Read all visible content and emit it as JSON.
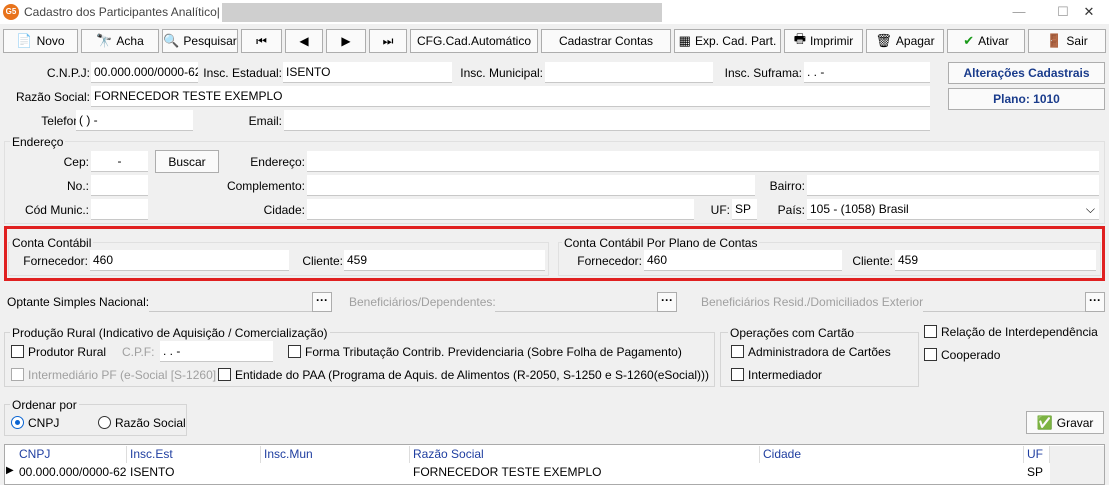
{
  "window": {
    "title": "Cadastro dos Participantes Analítico|",
    "icon_text": "G5"
  },
  "toolbar": {
    "novo": "Novo",
    "acha": "Acha",
    "pesquisar": "Pesquisar",
    "cfg": "CFG.Cad.Automático",
    "cadastrar_contas": "Cadastrar Contas",
    "exp": "Exp. Cad. Part.",
    "imprimir": "Imprimir",
    "apagar": "Apagar",
    "ativar": "Ativar",
    "sair": "Sair"
  },
  "side": {
    "alteracoes": "Alterações Cadastrais",
    "plano": "Plano: 1010"
  },
  "ident": {
    "cnpj_label": "C.N.P.J:",
    "cnpj": "00.000.000/0000-62",
    "ie_label": "Insc. Estadual:",
    "ie": "ISENTO",
    "im_label": "Insc. Municipal:",
    "im": "",
    "suframa_label": "Insc. Suframa:",
    "suframa": " .   .  -",
    "razao_label": "Razão Social:",
    "razao": "FORNECEDOR TESTE EXEMPLO",
    "tel_label": "Telefone:",
    "tel": "(  )    -",
    "email_label": "Email:",
    "email": ""
  },
  "endereco": {
    "group": "Endereço",
    "cep_label": "Cep:",
    "cep": "-",
    "buscar": "Buscar",
    "endereco_label": "Endereço:",
    "no_label": "No.:",
    "complemento_label": "Complemento:",
    "bairro_label": "Bairro:",
    "codmun_label": "Cód Munic.:",
    "cidade_label": "Cidade:",
    "uf_label": "UF:",
    "uf": "SP",
    "pais_label": "País:",
    "pais": "105 - (1058) Brasil"
  },
  "conta": {
    "group1": "Conta Contábil",
    "fornecedor_label": "Fornecedor:",
    "fornecedor": "460",
    "cliente_label": "Cliente:",
    "cliente": "459",
    "group2": "Conta Contábil Por Plano de Contas",
    "fornecedor2": "460",
    "cliente2": "459"
  },
  "extra": {
    "simples": "Optante Simples Nacional:",
    "benef": "Beneficiários/Dependentes:",
    "benef_ext": "Beneficiários Resid./Domiciliados Exterior:"
  },
  "rural": {
    "group": "Produção Rural (Indicativo de Aquisição / Comercialização)",
    "produtor": "Produtor Rural",
    "cpf_label": "C.P.F:",
    "cpf": " .   .   -",
    "forma": "Forma Tributação Contrib. Previdenciaria (Sobre Folha de Pagamento)",
    "intermediario": "Intermediário PF (e-Social [S-1260]",
    "entidade": "Entidade do PAA (Programa de Aquis. de Alimentos (R-2050, S-1250 e S-1260(eSocial)))"
  },
  "cartao": {
    "group": "Operações com Cartão",
    "adm": "Administradora de Cartões",
    "inter": "Intermediador"
  },
  "rel": {
    "interdep": "Relação de Interdependência",
    "cooperado": "Cooperado"
  },
  "ordenar": {
    "group": "Ordenar por",
    "cnpj": "CNPJ",
    "razao": "Razão Social"
  },
  "gravar": "Gravar",
  "grid": {
    "headers": [
      "CNPJ",
      "Insc.Est",
      "Insc.Mun",
      "Razão Social",
      "Cidade",
      "UF"
    ],
    "row": [
      "00.000.000/0000-62",
      "ISENTO",
      "",
      "FORNECEDOR TESTE EXEMPLO",
      "",
      "SP"
    ]
  },
  "colors": {
    "highlight": "#e02020",
    "accent": "#1a3c8c"
  }
}
